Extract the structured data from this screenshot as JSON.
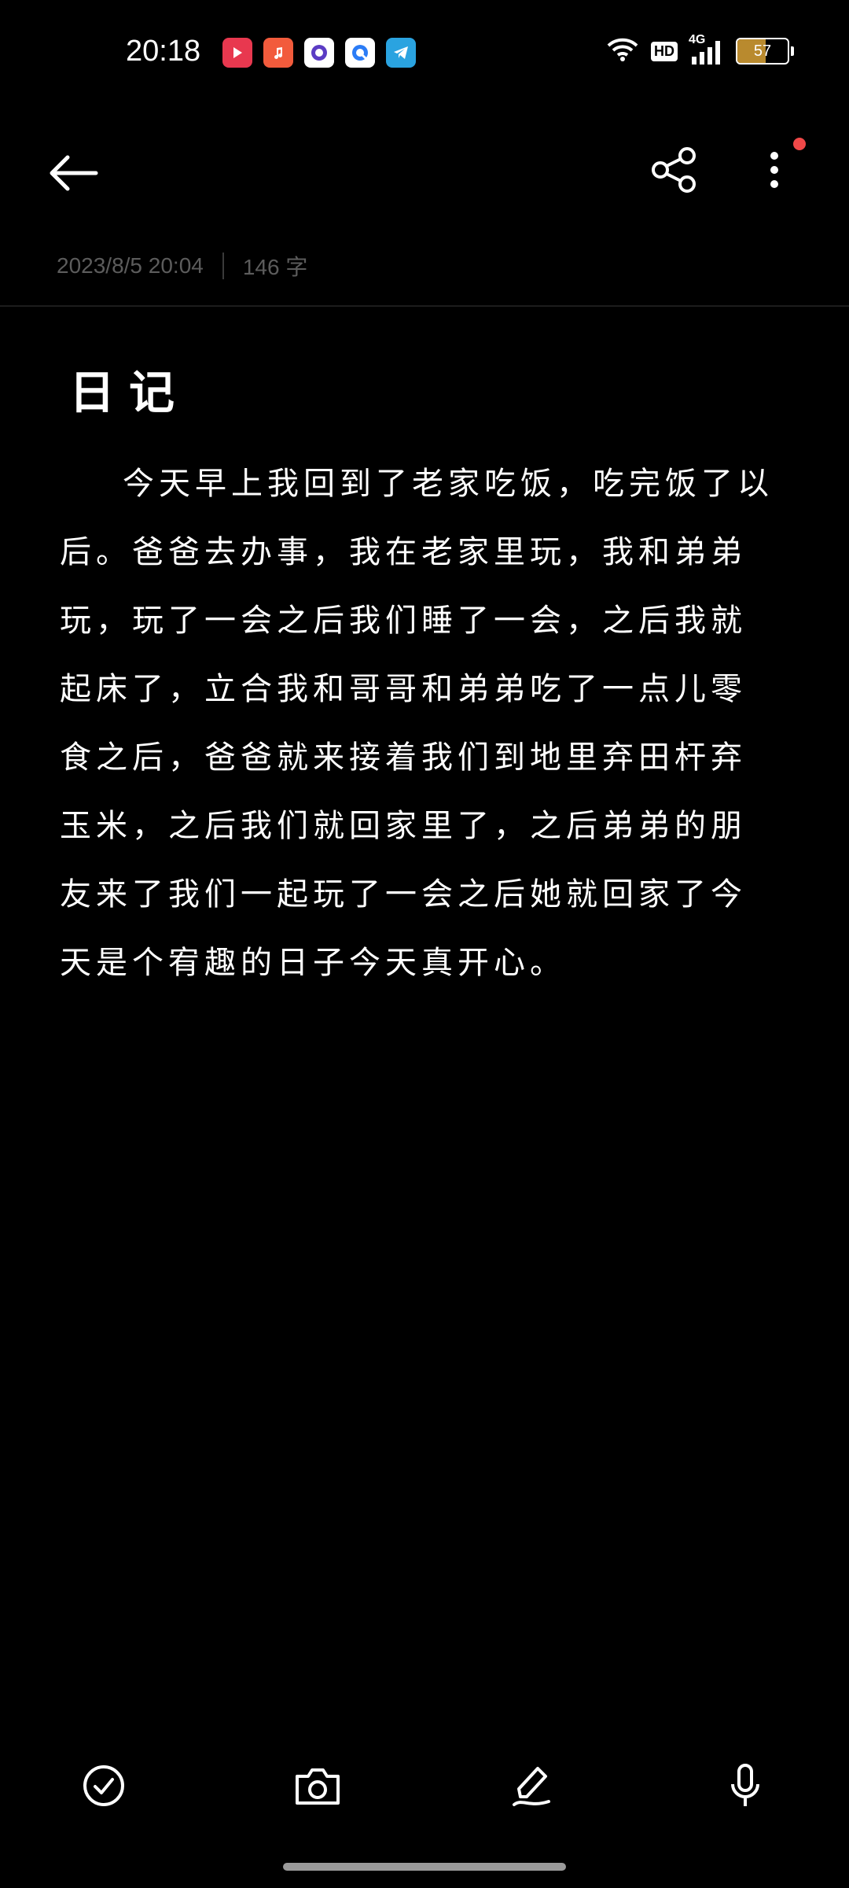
{
  "status_bar": {
    "time": "20:18",
    "apps": [
      {
        "name": "video-app-icon",
        "color": "#e8384f"
      },
      {
        "name": "music-app-icon",
        "color": "#f25b3c"
      },
      {
        "name": "browser-app-icon",
        "color": "#ffffff"
      },
      {
        "name": "qq-browser-app-icon",
        "color": "#ffffff"
      },
      {
        "name": "telegram-app-icon",
        "color": "#2aa3e0"
      }
    ],
    "hd_label": "HD",
    "network_label": "4G",
    "battery_level": 57,
    "battery_text": "57"
  },
  "toolbar": {
    "back_icon": "back-arrow-icon",
    "share_icon": "share-icon",
    "more_icon": "more-vertical-icon",
    "notification_dot_color": "#f04848"
  },
  "note": {
    "date": "2023/8/5 20:04",
    "word_count": "146 字",
    "title": "日记",
    "body": "今天早上我回到了老家吃饭，吃完饭了以后。爸爸去办事，我在老家里玩，我和弟弟玩，玩了一会之后我们睡了一会，之后我就起床了，立合我和哥哥和弟弟吃了一点儿零食之后，爸爸就来接着我们到地里弃田杆弃玉米，之后我们就回家里了，之后弟弟的朋友来了我们一起玩了一会之后她就回家了今天是个宥趣的日子今天真开心。"
  },
  "bottom_bar": {
    "items": [
      "checklist-icon",
      "camera-icon",
      "pen-icon",
      "microphone-icon"
    ]
  }
}
